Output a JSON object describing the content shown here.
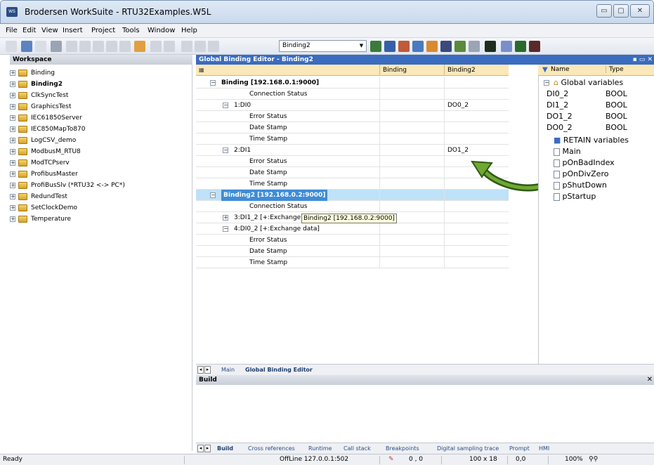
{
  "window": {
    "title": "Brodersen WorkSuite - RTU32Examples.W5L",
    "app_icon": "WS",
    "minimize": "▭",
    "restore": "▢",
    "close": "✕"
  },
  "menu": [
    "File",
    "Edit",
    "View",
    "Insert",
    "Project",
    "Tools",
    "Window",
    "Help"
  ],
  "toolbar": {
    "combo_value": "Binding2",
    "combo_arrow": "▼"
  },
  "workspace": {
    "title": "Workspace",
    "items": [
      {
        "label": "Binding",
        "bold": false
      },
      {
        "label": "Binding2",
        "bold": true
      },
      {
        "label": "ClkSyncTest",
        "bold": false
      },
      {
        "label": "GraphicsTest",
        "bold": false
      },
      {
        "label": "IEC61850Server",
        "bold": false
      },
      {
        "label": "IEC850MapTo870",
        "bold": false
      },
      {
        "label": "LogCSV_demo",
        "bold": false
      },
      {
        "label": "ModbusM_RTU8",
        "bold": false
      },
      {
        "label": "ModTCPserv",
        "bold": false
      },
      {
        "label": "ProfibusMaster",
        "bold": false
      },
      {
        "label": "ProfiBusSlv (*RTU32 <-> PC*)",
        "bold": false
      },
      {
        "label": "RedundTest",
        "bold": false
      },
      {
        "label": "SetClockDemo",
        "bold": false
      },
      {
        "label": "Temperature",
        "bold": false
      }
    ],
    "expander": "+"
  },
  "editor": {
    "title": "Global Binding Editor - Binding2",
    "columns": [
      "Binding",
      "Binding2"
    ],
    "rows": [
      {
        "name": "Binding [192.168.0.1:9000]",
        "indent": 0,
        "box": "−",
        "bold": true,
        "c1": "",
        "c2": ""
      },
      {
        "name": "Connection Status",
        "indent": 2,
        "box": "",
        "bold": false,
        "c1": "",
        "c2": ""
      },
      {
        "name": "1:DI0",
        "indent": 1,
        "box": "−",
        "bold": false,
        "c1": "",
        "c2": "DO0_2"
      },
      {
        "name": "Error Status",
        "indent": 2,
        "box": "",
        "bold": false,
        "c1": "",
        "c2": ""
      },
      {
        "name": "Date Stamp",
        "indent": 2,
        "box": "",
        "bold": false,
        "c1": "",
        "c2": ""
      },
      {
        "name": "Time Stamp",
        "indent": 2,
        "box": "",
        "bold": false,
        "c1": "",
        "c2": ""
      },
      {
        "name": "2:DI1",
        "indent": 1,
        "box": "−",
        "bold": false,
        "c1": "",
        "c2": "DO1_2"
      },
      {
        "name": "Error Status",
        "indent": 2,
        "box": "",
        "bold": false,
        "c1": "",
        "c2": ""
      },
      {
        "name": "Date Stamp",
        "indent": 2,
        "box": "",
        "bold": false,
        "c1": "",
        "c2": ""
      },
      {
        "name": "Time Stamp",
        "indent": 2,
        "box": "",
        "bold": false,
        "c1": "",
        "c2": ""
      },
      {
        "name": "Binding2 [192.168.0.2:9000]",
        "indent": 0,
        "box": "−",
        "bold": true,
        "selected": true,
        "c1": "",
        "c2": ""
      },
      {
        "name": "Connection Status",
        "indent": 2,
        "box": "",
        "bold": false,
        "c1": "",
        "c2": ""
      },
      {
        "name": "3:DI1_2 [+:Exchange data]",
        "indent": 1,
        "box": "+",
        "bold": false,
        "c1": "",
        "c2": ""
      },
      {
        "name": "4:DI0_2 [+:Exchange data]",
        "indent": 1,
        "box": "−",
        "bold": false,
        "c1": "",
        "c2": ""
      },
      {
        "name": "Error Status",
        "indent": 2,
        "box": "",
        "bold": false,
        "c1": "",
        "c2": ""
      },
      {
        "name": "Date Stamp",
        "indent": 2,
        "box": "",
        "bold": false,
        "c1": "",
        "c2": ""
      },
      {
        "name": "Time Stamp",
        "indent": 2,
        "box": "",
        "bold": false,
        "c1": "",
        "c2": ""
      }
    ],
    "tooltip": "Binding2 [192.168.0.2:9000]"
  },
  "variables": {
    "col_name": "Name",
    "col_type": "Type",
    "group": "Global variables",
    "items": [
      {
        "name": "DI0_2",
        "type": "BOOL"
      },
      {
        "name": "DI1_2",
        "type": "BOOL"
      },
      {
        "name": "DO1_2",
        "type": "BOOL"
      },
      {
        "name": "DO0_2",
        "type": "BOOL"
      }
    ],
    "retain": "RETAIN variables",
    "programs": [
      "Main",
      "pOnBadIndex",
      "pOnDivZero",
      "pShutDown",
      "pStartup"
    ]
  },
  "editor_tabs": [
    "Main",
    "Global Binding Editor"
  ],
  "build": {
    "title": "Build",
    "close": "✕"
  },
  "bottom_tabs": [
    "Build",
    "Cross references",
    "Runtime",
    "Call stack",
    "Breakpoints",
    "Digital sampling trace",
    "Prompt",
    "HMI"
  ],
  "status": {
    "ready": "Ready",
    "connection": "OffLine 127.0.0.1:502",
    "coords": "0 , 0",
    "size": "100 x 18",
    "pos": "0,0",
    "zoom": "100%"
  },
  "colors": {
    "arrow": "#3c6e1f",
    "header": "#fbe8b8",
    "selected": "#3f8cd6",
    "titlebar": "#c9d9ec"
  }
}
